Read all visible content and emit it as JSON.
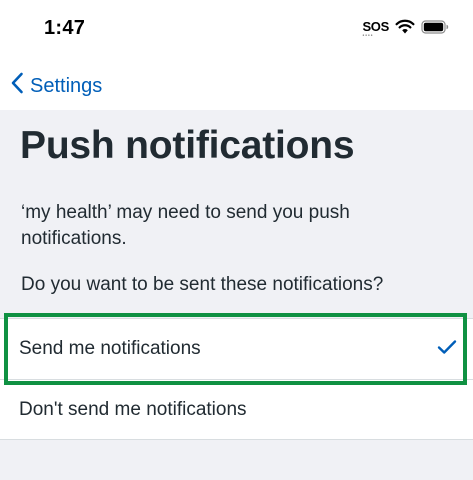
{
  "status_bar": {
    "time": "1:47",
    "sos": "SOS",
    "icons": [
      "sos-indicator",
      "wifi-icon",
      "battery-icon"
    ]
  },
  "nav": {
    "back_label": "Settings",
    "back_icon": "chevron-left-icon"
  },
  "page": {
    "title": "Push notifications",
    "intro": "‘my health’ may need to send you push notifications.",
    "question": "Do you want to be sent these notifications?"
  },
  "options": [
    {
      "label": "Send me notifications",
      "selected": true
    },
    {
      "label": "Don't send me notifications",
      "selected": false
    }
  ],
  "colors": {
    "accent": "#005eb8",
    "highlight": "#0f9142",
    "background": "#f0f1f5",
    "text": "#212b32"
  }
}
